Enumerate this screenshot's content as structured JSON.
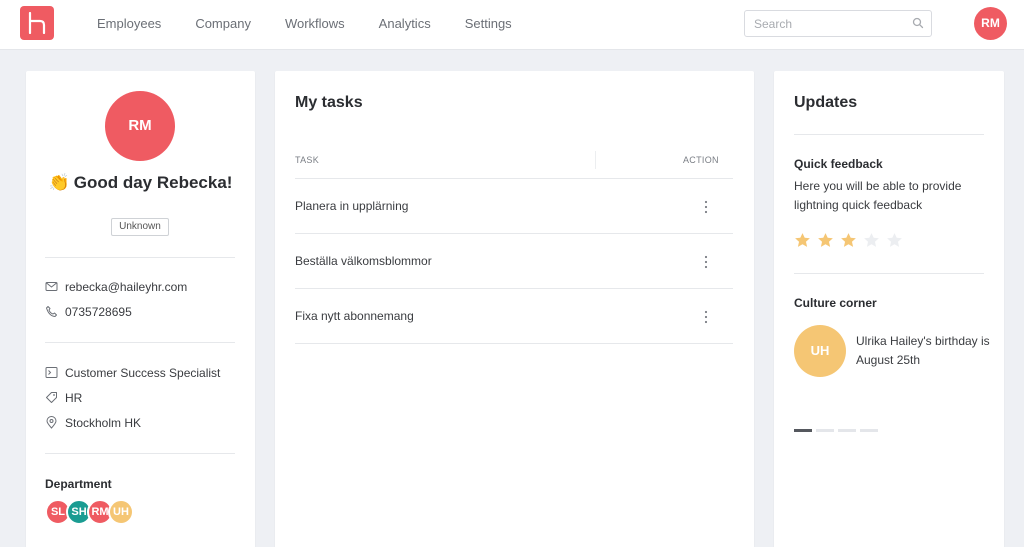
{
  "nav": {
    "items": [
      "Employees",
      "Company",
      "Workflows",
      "Analytics",
      "Settings"
    ],
    "search_placeholder": "Search",
    "user_initials": "RM"
  },
  "profile": {
    "initials": "RM",
    "greeting": "Good day Rebecka!",
    "greeting_emoji": "👏",
    "status_badge": "Unknown",
    "email": "rebecka@haileyhr.com",
    "phone": "0735728695",
    "job_title": "Customer Success Specialist",
    "department_tag": "HR",
    "location": "Stockholm HK",
    "department_label": "Department",
    "department_members": [
      {
        "initials": "SL",
        "color": "#ef5b62"
      },
      {
        "initials": "SH",
        "color": "#1a9c92"
      },
      {
        "initials": "RM",
        "color": "#ef5b62"
      },
      {
        "initials": "UH",
        "color": "#f5c674"
      }
    ]
  },
  "tasks": {
    "title": "My tasks",
    "col_task": "TASK",
    "col_action": "ACTION",
    "rows": [
      "Planera in upplärning",
      "Beställa välkomsblommor",
      "Fixa nytt abonnemang"
    ]
  },
  "updates": {
    "title": "Updates",
    "quick_feedback_title": "Quick feedback",
    "quick_feedback_text": "Here you will be able to provide lightning quick feedback",
    "rating": 3,
    "rating_max": 5,
    "culture_title": "Culture corner",
    "culture_initials": "UH",
    "culture_text": "Ulrika Hailey's birthday is August 25th",
    "carousel_count": 4,
    "carousel_active": 0
  },
  "colors": {
    "brand": "#ef5b62",
    "star_on": "#f5c674",
    "star_off": "#eceef1"
  }
}
